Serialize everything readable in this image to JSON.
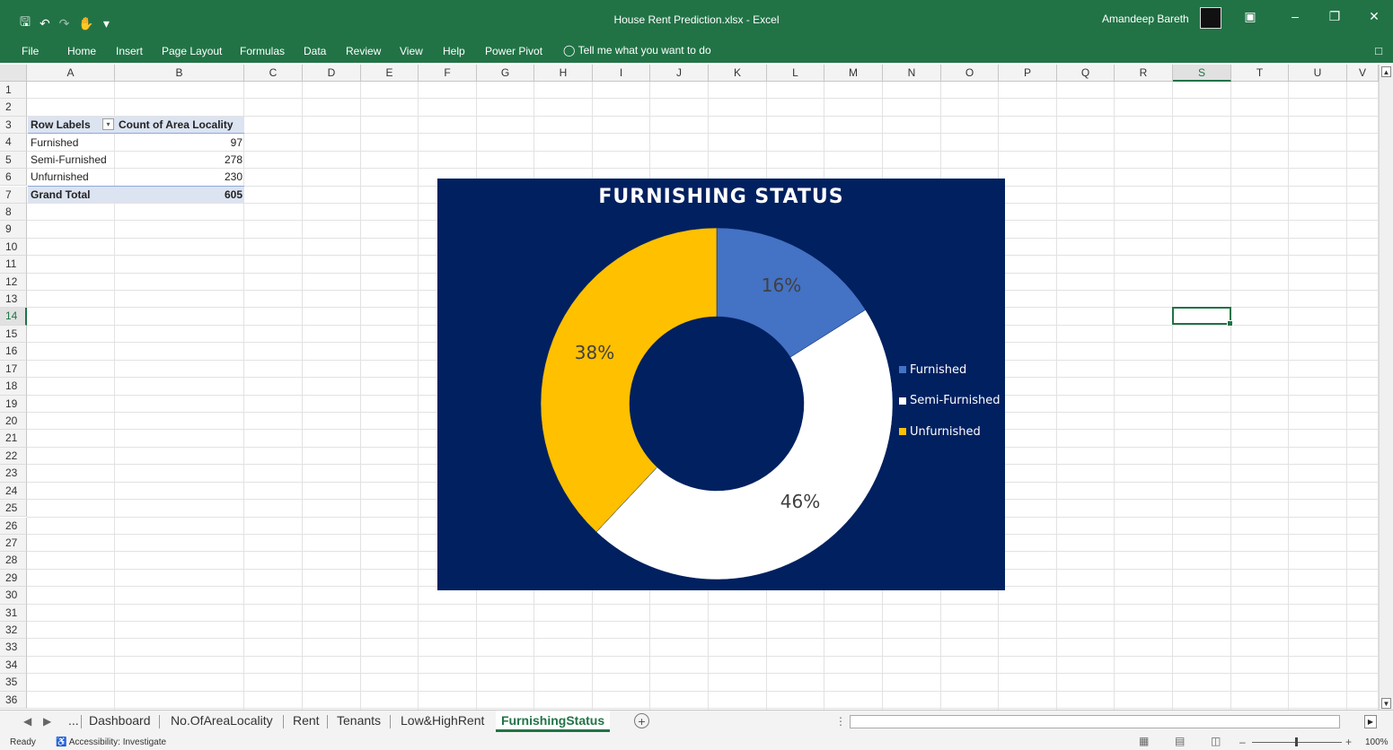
{
  "window": {
    "title": "House Rent Prediction.xlsx  -  Excel",
    "user_name": "Amandeep Bareth"
  },
  "menu": {
    "items": [
      "File",
      "Home",
      "Insert",
      "Page Layout",
      "Formulas",
      "Data",
      "Review",
      "View",
      "Help",
      "Power Pivot"
    ],
    "tell_me": "Tell me what you want to do"
  },
  "grid": {
    "columns": [
      "A",
      "B",
      "C",
      "D",
      "E",
      "F",
      "G",
      "H",
      "I",
      "J",
      "K",
      "L",
      "M",
      "N",
      "O",
      "P",
      "Q",
      "R",
      "S",
      "T",
      "U",
      "V"
    ],
    "rows": [
      "1",
      "2",
      "3",
      "4",
      "5",
      "6",
      "7",
      "8",
      "9",
      "10",
      "11",
      "12",
      "13",
      "14",
      "15",
      "16",
      "17",
      "18",
      "19",
      "20",
      "21",
      "22",
      "23",
      "24",
      "25",
      "26",
      "27",
      "28",
      "29",
      "30",
      "31",
      "32",
      "33",
      "34",
      "35",
      "36"
    ],
    "selected_column": "S",
    "selected_row": "14"
  },
  "pivot": {
    "header_label": "Row Labels",
    "header_value": "Count of Area Locality",
    "rows": [
      {
        "label": "Furnished",
        "value": "97"
      },
      {
        "label": "Semi-Furnished",
        "value": "278"
      },
      {
        "label": "Unfurnished",
        "value": "230"
      }
    ],
    "total_label": "Grand Total",
    "total_value": "605"
  },
  "chart_data": {
    "type": "pie",
    "variant": "doughnut",
    "title": "FURNISHING STATUS",
    "categories": [
      "Furnished",
      "Semi-Furnished",
      "Unfurnished"
    ],
    "values": [
      97,
      278,
      230
    ],
    "data_labels": [
      "16%",
      "46%",
      "38%"
    ],
    "colors": [
      "#4472c4",
      "#ffffff",
      "#ffc000"
    ],
    "background": "#002060",
    "legend_position": "right"
  },
  "sheets": {
    "nav_ellipsis": "...",
    "tabs": [
      "Dashboard",
      "No.OfAreaLocality",
      "Rent",
      "Tenants",
      "Low&HighRent",
      "FurnishingStatus"
    ],
    "active": "FurnishingStatus"
  },
  "status": {
    "ready": "Ready",
    "accessibility": "Accessibility: Investigate",
    "zoom": "100%"
  },
  "colors": {
    "excel_green": "#217346",
    "pivot_header": "#dce3f1"
  }
}
